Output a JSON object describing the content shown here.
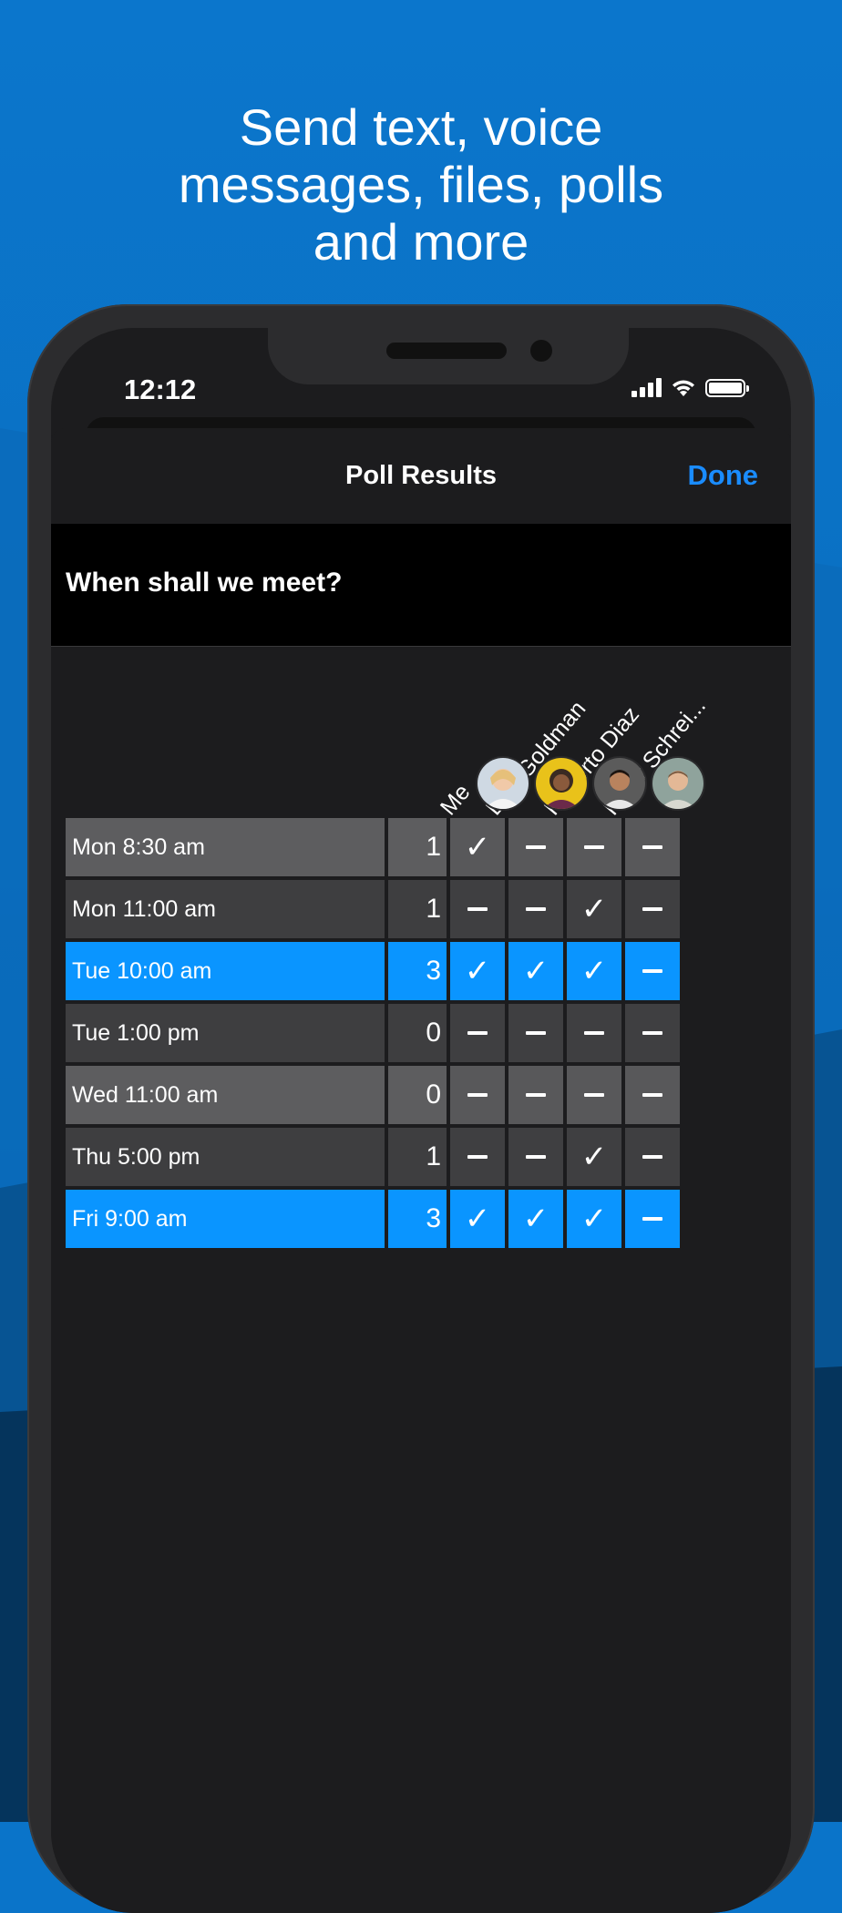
{
  "promo": {
    "headline_lines": [
      "Send text, voice",
      "messages, files, polls",
      "and more"
    ]
  },
  "status_bar": {
    "time": "12:12"
  },
  "nav": {
    "title": "Poll Results",
    "done_label": "Done"
  },
  "poll": {
    "question": "When shall we meet?",
    "participants": [
      "Me",
      "Lisa Goldman",
      "Roberto Diaz",
      "Peter Schrei..."
    ],
    "rows": [
      {
        "label": "Mon 8:30 am",
        "count": "1",
        "votes": [
          "✓",
          "-",
          "-",
          "-"
        ]
      },
      {
        "label": "Mon 11:00 am",
        "count": "1",
        "votes": [
          "-",
          "-",
          "✓",
          "-"
        ]
      },
      {
        "label": "Tue 10:00 am",
        "count": "3",
        "votes": [
          "✓",
          "✓",
          "✓",
          "-"
        ]
      },
      {
        "label": "Tue 1:00 pm",
        "count": "0",
        "votes": [
          "-",
          "-",
          "-",
          "-"
        ]
      },
      {
        "label": "Wed 11:00 am",
        "count": "0",
        "votes": [
          "-",
          "-",
          "-",
          "-"
        ]
      },
      {
        "label": "Thu 5:00 pm",
        "count": "1",
        "votes": [
          "-",
          "-",
          "✓",
          "-"
        ]
      },
      {
        "label": "Fri 9:00 am",
        "count": "3",
        "votes": [
          "✓",
          "✓",
          "✓",
          "-"
        ]
      }
    ]
  },
  "colors": {
    "accent": "#0a95ff",
    "done": "#1a8cff",
    "background": "#0a74c9"
  }
}
